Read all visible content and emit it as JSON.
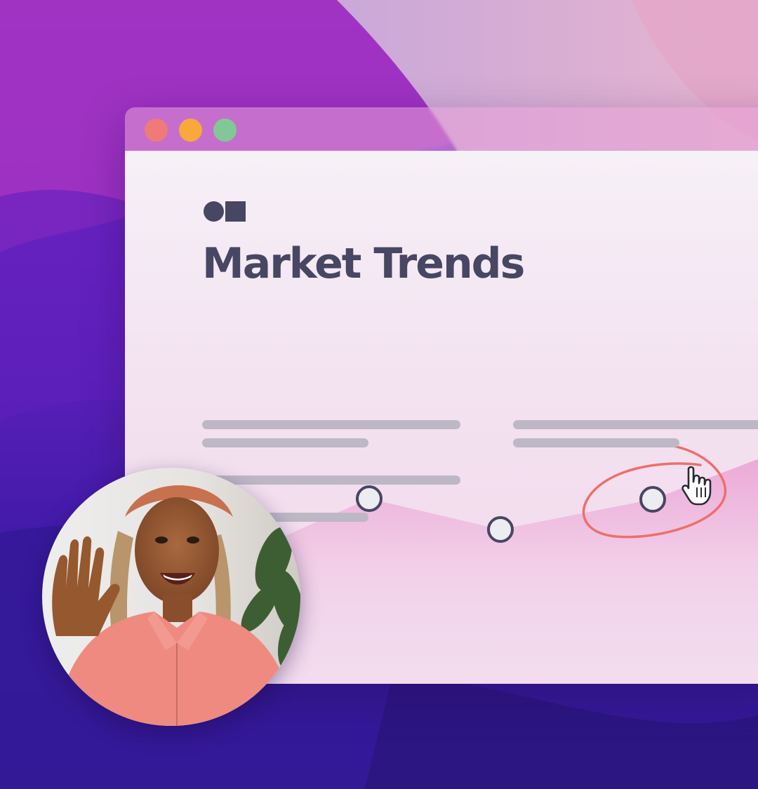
{
  "window": {
    "traffic_lights": [
      {
        "name": "close",
        "color": "#ef7b79"
      },
      {
        "name": "minimize",
        "color": "#f7a93b"
      },
      {
        "name": "zoom",
        "color": "#82c897"
      }
    ]
  },
  "document": {
    "title": "Market Trends",
    "logo_icon": "circle-square-logo",
    "text_color": "#474663"
  },
  "chart": {
    "points_visible": 3,
    "highlighted_point_index": 2,
    "annotation_color": "#ee6f6b",
    "cursor_icon": "pointing-hand-cursor"
  },
  "webcam": {
    "icon": "presenter-webcam-bubble"
  },
  "colors": {
    "wallpaper_purple": "#5a1fb8",
    "wallpaper_magenta": "#c642b0",
    "chart_fill": "#ecb0d8",
    "placeholder_line": "#bdb7c6"
  }
}
